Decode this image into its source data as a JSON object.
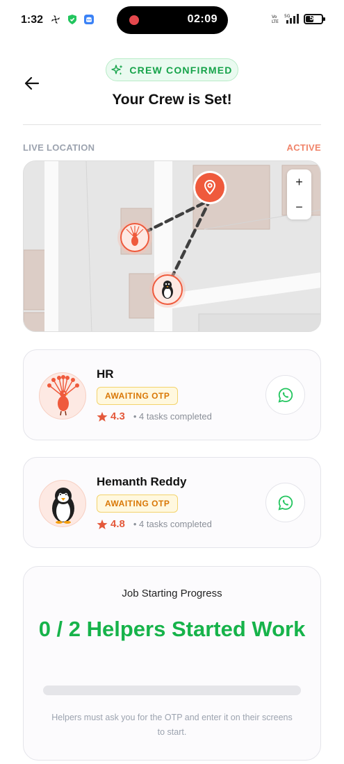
{
  "status_bar": {
    "time": "1:32",
    "recording_time": "02:09",
    "battery_level": "55",
    "network": "5G"
  },
  "header": {
    "badge_label": "CREW CONFIRMED",
    "title": "Your Crew is Set!"
  },
  "location": {
    "label": "LIVE LOCATION",
    "status": "ACTIVE",
    "zoom_in": "+",
    "zoom_out": "−"
  },
  "helpers": [
    {
      "name": "HR",
      "status": "AWAITING OTP",
      "rating": "4.3",
      "tasks": "• 4 tasks completed",
      "avatar_icon": "peacock-icon"
    },
    {
      "name": "Hemanth Reddy",
      "status": "AWAITING OTP",
      "rating": "4.8",
      "tasks": "• 4 tasks completed",
      "avatar_icon": "penguin-icon"
    }
  ],
  "progress": {
    "title": "Job Starting Progress",
    "headline": "0 / 2 Helpers Started Work",
    "started": 0,
    "total": 2,
    "note": "Helpers must ask you for the OTP and enter it on their screens to start."
  },
  "colors": {
    "accent_green": "#16b34a",
    "accent_orange": "#f0846a",
    "marker_red": "#ef5a3c",
    "otp_amber": "#d97706"
  }
}
